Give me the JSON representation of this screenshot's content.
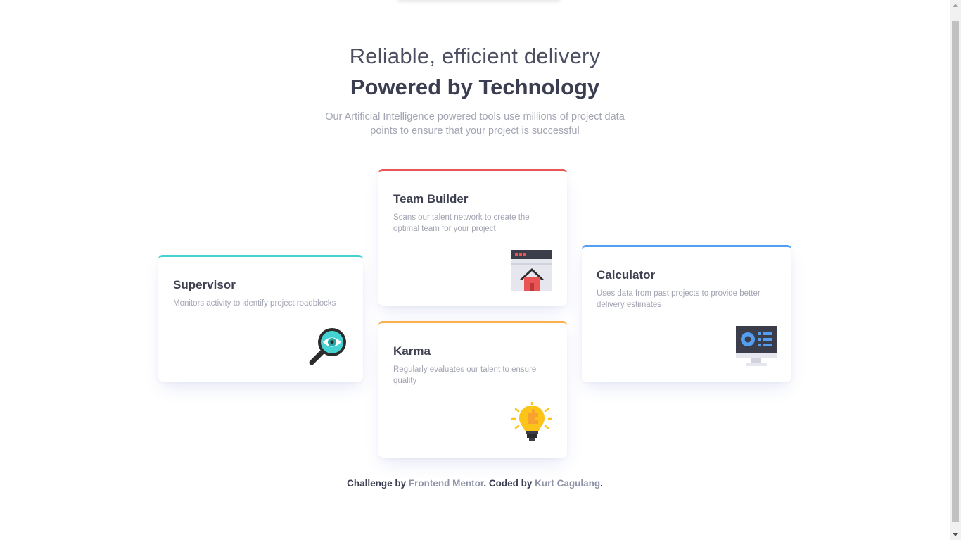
{
  "header": {
    "title_light": "Reliable, efficient delivery",
    "title_bold": "Powered by Technology",
    "subtitle": "Our Artificial Intelligence powered tools use millions of project data points to ensure that your project is successful"
  },
  "cards": {
    "supervisor": {
      "title": "Supervisor",
      "description": "Monitors activity to identify project roadblocks",
      "accent": "#44d3d2",
      "icon": "magnifier-eye-icon"
    },
    "team_builder": {
      "title": "Team Builder",
      "description": "Scans our talent network to create the optimal team for your project",
      "accent": "#ea5454",
      "icon": "browser-house-icon"
    },
    "karma": {
      "title": "Karma",
      "description": "Regularly evaluates our talent to ensure quality",
      "accent": "#fcaf4a",
      "icon": "lightbulb-puzzle-icon"
    },
    "calculator": {
      "title": "Calculator",
      "description": "Uses data from past projects to provide better delivery estimates",
      "accent": "#549ef2",
      "icon": "monitor-chart-icon"
    }
  },
  "footer": {
    "challenge_by": "Challenge by ",
    "frontend_mentor": "Frontend Mentor",
    "coded_by": ". Coded by ",
    "author": "Kurt Cagulang",
    "end": "."
  }
}
